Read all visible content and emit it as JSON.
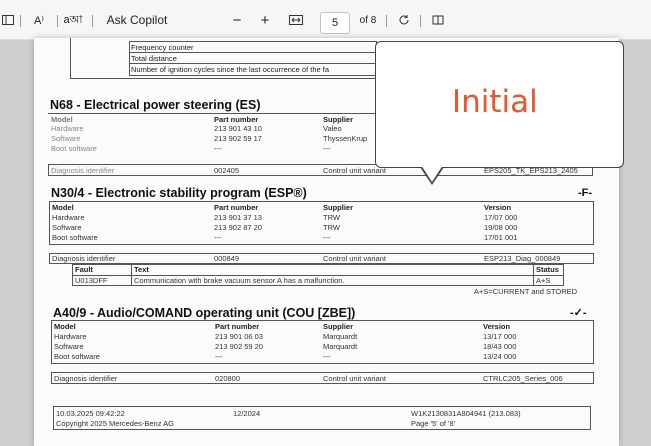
{
  "toolbar": {
    "read_aloud": "A⁾",
    "translate": "aআ",
    "ask_copilot": "Ask Copilot",
    "zoom_out": "−",
    "zoom_in": "+",
    "page_number": "5",
    "page_of": "of 8"
  },
  "top_table": {
    "rows": [
      "Frequency counter",
      "Total distance",
      "Number of ignition cycles since the last occurrence of the fa"
    ]
  },
  "es": {
    "title": "N68 - Electrical power steering (ES)",
    "col_part": "Part number",
    "col_supplier": "Supplier",
    "rows": [
      {
        "label": "Model",
        "part": "",
        "supplier": ""
      },
      {
        "label": "Hardware",
        "part": "213 901 43 10",
        "supplier": "Valeo"
      },
      {
        "label": "Software",
        "part": "213 902 59 17",
        "supplier": "ThyssenKrup"
      },
      {
        "label": "Boot software",
        "part": "---",
        "supplier": "---"
      }
    ],
    "diag_label": "Diagnosis identifier",
    "diag_value": "002405",
    "variant_label": "Control unit variant",
    "variant_value": "EPS205_TK_EPS213_2405"
  },
  "esp": {
    "title": "N30/4 - Electronic stability program (ESP®)",
    "flag": "-F-",
    "col_part": "Part number",
    "col_supplier": "Supplier",
    "col_version": "Version",
    "rows": [
      {
        "label": "Model",
        "part": "",
        "supplier": "",
        "version": ""
      },
      {
        "label": "Hardware",
        "part": "213 901 37 13",
        "supplier": "TRW",
        "version": "17/07 000"
      },
      {
        "label": "Software",
        "part": "213 902 87 20",
        "supplier": "TRW",
        "version": "19/08 000"
      },
      {
        "label": "Boot software",
        "part": "---",
        "supplier": "---",
        "version": "17/01 001"
      }
    ],
    "diag_label": "Diagnosis identifier",
    "diag_value": "000849",
    "variant_label": "Control unit variant",
    "variant_value": "ESP213_Diag_000849",
    "fault_header": "Fault",
    "text_header": "Text",
    "status_header": "Status",
    "fault_code": "U013DFF",
    "fault_text": "Communication with brake vacuum sensor A has a malfunction.",
    "fault_status": "A+S",
    "legend": "A+S=CURRENT and STORED"
  },
  "cou": {
    "title": "A40/9 - Audio/COMAND operating unit (COU [ZBE])",
    "flag": "-✓-",
    "col_part": "Part number",
    "col_supplier": "Supplier",
    "col_version": "Version",
    "rows": [
      {
        "label": "Model",
        "part": "",
        "supplier": "",
        "version": ""
      },
      {
        "label": "Hardware",
        "part": "213 901 06 03",
        "supplier": "Marquardt",
        "version": "13/17 000"
      },
      {
        "label": "Software",
        "part": "213 902 59 20",
        "supplier": "Marquardt",
        "version": "18/43 000"
      },
      {
        "label": "Boot software",
        "part": "---",
        "supplier": "---",
        "version": "13/24 000"
      }
    ],
    "diag_label": "Diagnosis identifier",
    "diag_value": "020800",
    "variant_label": "Control unit variant",
    "variant_value": "CTRLC205_Series_006"
  },
  "footer": {
    "datetime": "10.03.2025 09:42:22",
    "copyright": "Copyright 2025 Mercedes-Benz AG",
    "version": "12/2024",
    "vin": "W1K2130831A804941 (213.083)",
    "page": "Page '5' of '8'"
  },
  "tooltip": {
    "text": "Initial",
    "color": "#e2592e"
  }
}
